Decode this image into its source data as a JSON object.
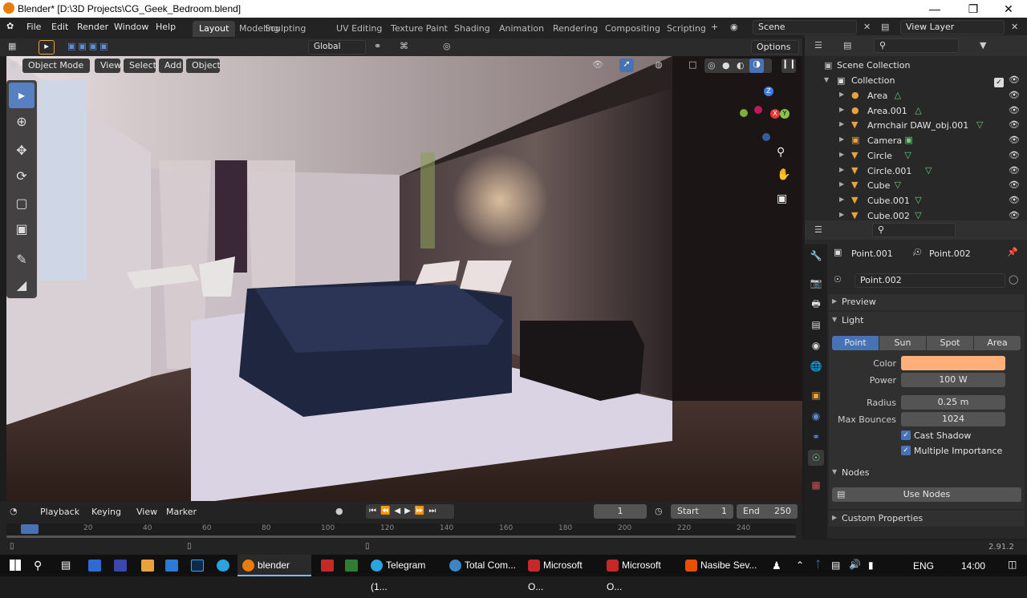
{
  "window": {
    "title": "Blender* [D:\\3D Projects\\CG_Geek_Bedroom.blend]"
  },
  "menu": [
    "File",
    "Edit",
    "Render",
    "Window",
    "Help"
  ],
  "workspaces": [
    "Layout",
    "Modeling",
    "Sculpting",
    "UV Editing",
    "Texture Paint",
    "Shading",
    "Animation",
    "Rendering",
    "Compositing",
    "Scripting"
  ],
  "active_workspace": "Layout",
  "scene": {
    "name": "Scene",
    "view_layer": "View Layer"
  },
  "header": {
    "transform_orientation": "Global",
    "options": "Options"
  },
  "viewport_header": {
    "mode": "Object Mode",
    "menus": [
      "View",
      "Select",
      "Add",
      "Object"
    ]
  },
  "outliner": {
    "root": "Scene Collection",
    "collection": "Collection",
    "items": [
      {
        "name": "Area",
        "type": "light"
      },
      {
        "name": "Area.001",
        "type": "light"
      },
      {
        "name": "Armchair DAW_obj.001",
        "type": "mesh"
      },
      {
        "name": "Camera",
        "type": "camera"
      },
      {
        "name": "Circle",
        "type": "mesh"
      },
      {
        "name": "Circle.001",
        "type": "mesh"
      },
      {
        "name": "Cube",
        "type": "mesh"
      },
      {
        "name": "Cube.001",
        "type": "mesh"
      },
      {
        "name": "Cube.002",
        "type": "mesh"
      }
    ]
  },
  "properties": {
    "breadcrumb": [
      "Point.001",
      "Point.002"
    ],
    "datablock": "Point.002",
    "panels": {
      "preview": "Preview",
      "light": "Light",
      "nodes": "Nodes",
      "custom": "Custom Properties"
    },
    "light_types": [
      "Point",
      "Sun",
      "Spot",
      "Area"
    ],
    "active_light_type": "Point",
    "color_label": "Color",
    "color_value": "#ffb07a",
    "power_label": "Power",
    "power": "100 W",
    "radius_label": "Radius",
    "radius": "0.25 m",
    "bounces_label": "Max Bounces",
    "bounces": "1024",
    "cast_shadow": "Cast Shadow",
    "multiple_importance": "Multiple Importance",
    "use_nodes": "Use Nodes"
  },
  "timeline": {
    "menus": [
      "Playback",
      "Keying",
      "View",
      "Marker"
    ],
    "current_frame": "1",
    "start_label": "Start",
    "start": "1",
    "end_label": "End",
    "end": "250",
    "ticks": [
      "1",
      "20",
      "40",
      "60",
      "80",
      "100",
      "120",
      "140",
      "160",
      "180",
      "200",
      "220",
      "240"
    ]
  },
  "status": {
    "version": "2.91.2"
  },
  "taskbar": {
    "items": [
      "blender",
      "Telegram (1...",
      "Total Com...",
      "Microsoft O...",
      "Microsoft O...",
      "Nasibe Sev..."
    ],
    "lang": "ENG",
    "time": "14:00"
  }
}
